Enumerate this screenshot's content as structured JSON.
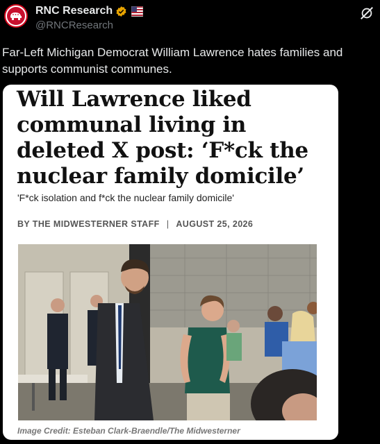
{
  "author": {
    "name": "RNC Research",
    "handle": "@RNCResearch"
  },
  "tweet": {
    "text": "Far-Left Michigan Democrat William Lawrence hates families and supports communist communes."
  },
  "card": {
    "headline": "Will Lawrence liked communal living in deleted X post: ‘F*ck the nuclear family domicile’",
    "subheadline": "'F*ck isolation and f*ck the nuclear family domicile'",
    "byline": "BY THE MIDWESTERNER STAFF",
    "separator": "|",
    "date": "AUGUST 25, 2026",
    "image_credit": "Image Credit: Esteban Clark-Braendle/The Midwesterner"
  },
  "colors": {
    "background": "#000000",
    "text_primary": "#e7e9ea",
    "text_secondary": "#71767b",
    "verified": "#e8a400",
    "rnc_red": "#c8102e"
  },
  "icons": [
    "rnc-elephant-icon",
    "verified-badge-icon",
    "us-flag-icon",
    "grok-icon"
  ]
}
